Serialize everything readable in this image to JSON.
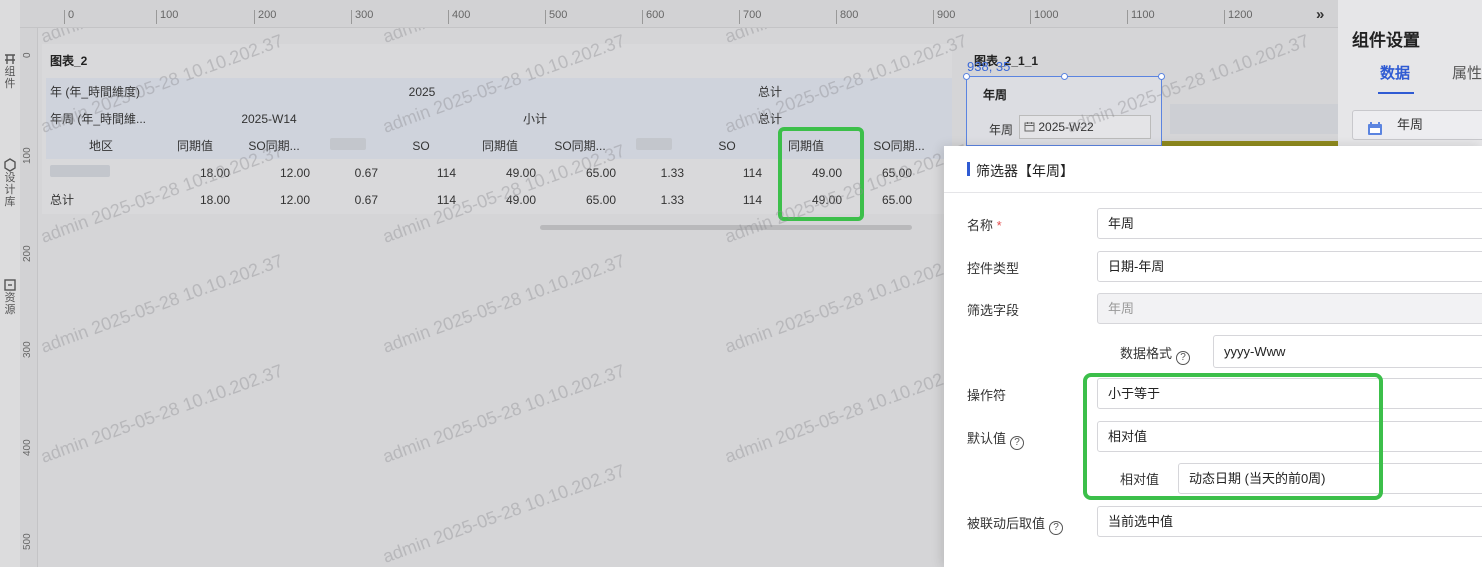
{
  "left_toolbar": {
    "items": [
      {
        "icon": "component-icon",
        "label": "组件"
      },
      {
        "icon": "design-library-icon",
        "label": "设计库"
      },
      {
        "icon": "resource-icon",
        "label": "资源"
      }
    ]
  },
  "ruler": {
    "h_ticks": [
      "0",
      "100",
      "200",
      "300",
      "400",
      "500",
      "600",
      "700",
      "800",
      "900",
      "1000",
      "1100",
      "1200"
    ],
    "v_ticks": [
      "0",
      "100",
      "200",
      "300",
      "400",
      "500"
    ],
    "collapse_glyph": "»"
  },
  "watermark": "admin 2025-05-28 10.10.202.37",
  "chart2": {
    "title": "图表_2",
    "rows": {
      "year_header": {
        "label": "年 (年_時間維度)",
        "year": "2025",
        "total": "总计"
      },
      "week_header": {
        "label": "年周 (年_時間維...",
        "week": "2025-W14",
        "subtotal": "小计",
        "total": "总计"
      },
      "measure_header": {
        "label": "地区",
        "cols": [
          "同期值",
          "SO同期...",
          "",
          "SO",
          "同期值",
          "SO同期...",
          "",
          "SO",
          "同期值",
          "SO同期..."
        ]
      },
      "data_row": {
        "label": "",
        "cells": [
          "18.00",
          "12.00",
          "0.67",
          "114",
          "49.00",
          "65.00",
          "1.33",
          "114",
          "49.00",
          "65.00"
        ]
      },
      "total_row": {
        "label": "总计",
        "cells": [
          "18.00",
          "12.00",
          "0.67",
          "114",
          "49.00",
          "65.00",
          "1.33",
          "114",
          "49.00",
          "65.00"
        ]
      }
    }
  },
  "chart211": {
    "title": "图表_2_1_1",
    "coord_readout": "938, 35",
    "filter_widget": {
      "title": "年周",
      "label": "年周",
      "value": "2025-W22",
      "calendar_icon": "calendar-icon"
    }
  },
  "right_panel": {
    "title": "组件设置",
    "tab_data": "数据",
    "tab_props": "属性",
    "field_label": "年周",
    "field_icon": "calendar-icon"
  },
  "dialog": {
    "title": "筛选器【年周】",
    "name_label": "名称",
    "name_required": "*",
    "name_value": "年周",
    "control_type_label": "控件类型",
    "control_type_value": "日期-年周",
    "filter_field_label": "筛选字段",
    "filter_field_value": "年周",
    "data_format_label": "数据格式",
    "data_format_value": "yyyy-Www",
    "operator_label": "操作符",
    "operator_value": "小于等于",
    "default_label": "默认值",
    "default_value": "相对值",
    "relative_label": "相对值",
    "relative_value": "动态日期 (当天的前0周)",
    "linked_label": "被联动后取值",
    "linked_value": "当前选中值",
    "help_glyph": "?"
  },
  "colors": {
    "accent": "#2f5bd3",
    "highlight_green": "#3cbf4a",
    "required_red": "#e34d4d"
  }
}
